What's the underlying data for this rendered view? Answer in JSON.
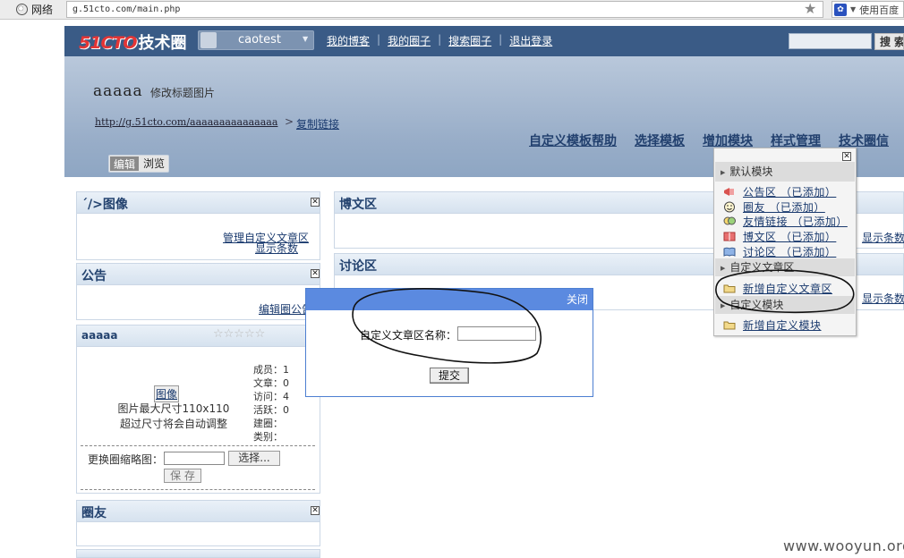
{
  "browser": {
    "net_label": "网络",
    "url": "g.51cto.com/main.php",
    "search_engine_label": "使用百度"
  },
  "site": {
    "logo_brand": "51CTO",
    "logo_text": "技术圈",
    "username": "caotest",
    "topnav": [
      "我的博客",
      "我的圈子",
      "搜索圈子",
      "退出登录"
    ],
    "search_button": "搜索",
    "search_value": ""
  },
  "header": {
    "blog_title": "aaaaa",
    "edit_title_image": "修改标题图片",
    "blog_url": "http://g.51cto.com/aaaaaaaaaaaaaaa",
    "url_separator": ">",
    "copy_link": "复制链接",
    "mainnav": [
      "自定义模板帮助",
      "选择模板",
      "增加模块",
      "样式管理",
      "技术圈信"
    ],
    "mode_tabs": [
      "编辑",
      "浏览"
    ]
  },
  "left": {
    "image_panel": {
      "title": "´/>图像",
      "link1": "管理自定义文章区",
      "link2": "显示条数"
    },
    "notice_panel": {
      "title": "公告",
      "link": "编辑圈公告"
    },
    "circle_panel": {
      "title": "aaaaa",
      "stars": "☆☆☆☆☆",
      "image_label": "图像",
      "image_hint1": "图片最大尺寸110x110",
      "image_hint2": "超过尺寸将会自动调整",
      "stats": [
        "成员：1",
        "文章：0",
        "访问：4",
        "活跃：0",
        "建圈：",
        "类别："
      ],
      "thumb_label": "更换圈缩略图：",
      "thumb_value": "",
      "choose_button": "选择...",
      "save_button": "保 存"
    },
    "friends_panel": {
      "title": "圈友"
    }
  },
  "middle": {
    "blog_panel": {
      "title": "博文区",
      "link": "显示条数"
    },
    "discuss_panel": {
      "title": "讨论区",
      "link": "显示条数"
    }
  },
  "module_menu": {
    "default_section": "默认模块",
    "default_items": [
      "公告区 （已添加）",
      "圈友 （已添加）",
      "友情链接 （已添加）",
      "博文区 （已添加）",
      "讨论区 （已添加）"
    ],
    "article_section": "自定义文章区",
    "article_item": "新增自定义文章区",
    "custom_section": "自定义模块",
    "custom_item": "新增自定义模块"
  },
  "dialog": {
    "close_label": "关闭",
    "field_label": "自定义文章区名称：",
    "field_value": "",
    "submit_label": "提交"
  },
  "watermark": "www.wooyun.org",
  "colors": {
    "topbar": "#3a5b86",
    "dialog_header": "#5b8ae0",
    "logo_red": "#e43535",
    "link": "#1a3a6e"
  }
}
